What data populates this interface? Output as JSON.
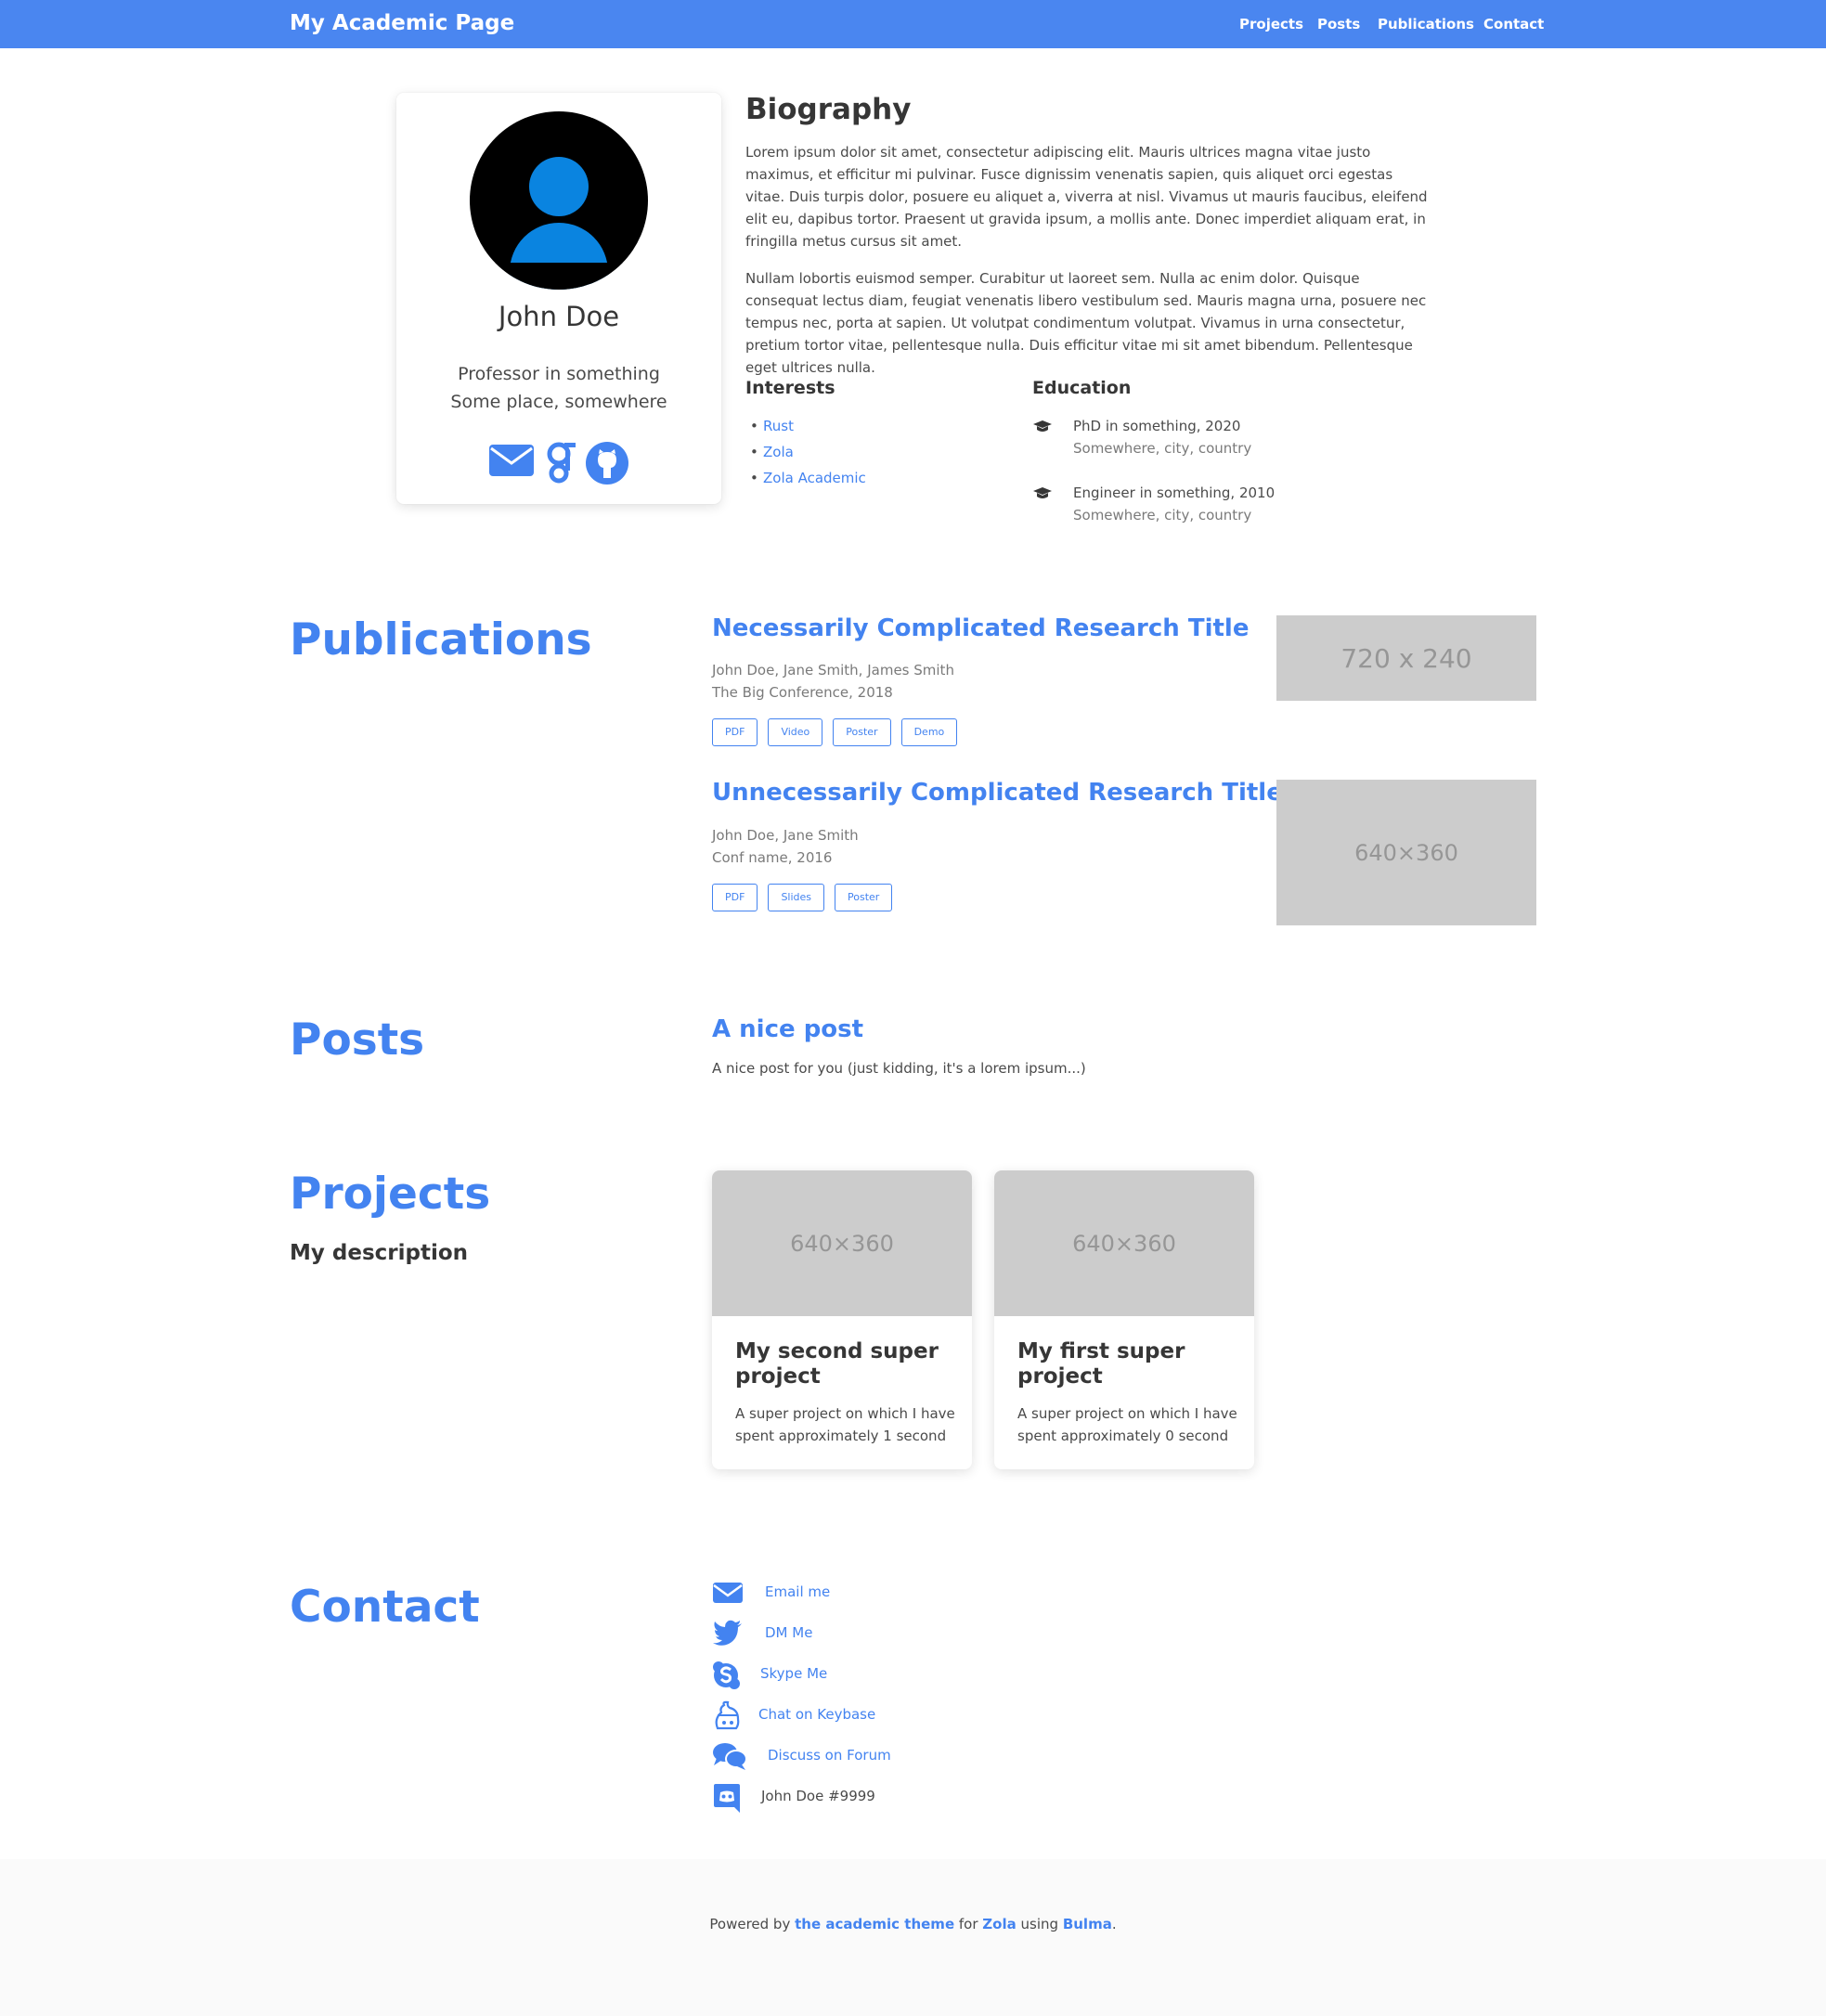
{
  "navbar": {
    "brand": "My Academic Page",
    "links": [
      "Projects",
      "Posts",
      "Publications",
      "Contact"
    ]
  },
  "profile": {
    "name": "John Doe",
    "title": "Professor in something",
    "location": "Some place, somewhere",
    "icons": [
      "envelope-icon",
      "google-scholar-icon",
      "github-icon"
    ]
  },
  "biography": {
    "title": "Biography",
    "paragraphs": [
      "Lorem ipsum dolor sit amet, consectetur adipiscing elit. Mauris ultrices magna vitae justo maximus, et efficitur mi pulvinar. Fusce dignissim venenatis sapien, quis aliquet orci egestas vitae. Duis turpis dolor, posuere eu aliquet a, viverra at nisl. Vivamus ut mauris faucibus, eleifend elit eu, dapibus tortor. Praesent ut gravida ipsum, a mollis ante. Donec imperdiet aliquam erat, in fringilla metus cursus sit amet.",
      "Nullam lobortis euismod semper. Curabitur ut laoreet sem. Nulla ac enim dolor. Quisque consequat lectus diam, feugiat venenatis libero vestibulum sed. Mauris magna urna, posuere nec tempus nec, porta at sapien. Ut volutpat condimentum volutpat. Vivamus in urna consectetur, pretium tortor vitae, pellentesque nulla. Duis efficitur vitae mi sit amet bibendum. Pellentesque eget ultrices nulla."
    ],
    "interests_title": "Interests",
    "interests": [
      "Rust",
      "Zola",
      "Zola Academic"
    ],
    "education_title": "Education",
    "education": [
      {
        "degree": "PhD in something, 2020",
        "place": "Somewhere, city, country"
      },
      {
        "degree": "Engineer in something, 2010",
        "place": "Somewhere, city, country"
      }
    ]
  },
  "publications": {
    "title": "Publications",
    "items": [
      {
        "title": "Necessarily Complicated Research Title",
        "authors": "John Doe, Jane Smith, James Smith",
        "venue": "The Big Conference, 2018",
        "tags": [
          "PDF",
          "Video",
          "Poster",
          "Demo"
        ],
        "image": "720 x 240"
      },
      {
        "title": "Unnecessarily Complicated Research Title",
        "authors": "John Doe, Jane Smith",
        "venue": "Conf name, 2016",
        "tags": [
          "PDF",
          "Slides",
          "Poster"
        ],
        "image": "640×360"
      }
    ]
  },
  "posts": {
    "title": "Posts",
    "items": [
      {
        "title": "A nice post",
        "summary": "A nice post for you (just kidding, it's a lorem ipsum...)"
      }
    ]
  },
  "projects": {
    "title": "Projects",
    "description": "My description",
    "items": [
      {
        "image": "640×360",
        "name": "My second super project",
        "text": "A super project on which I have spent approximately 1 second"
      },
      {
        "image": "640×360",
        "name": "My first super project",
        "text": "A super project on which I have spent approximately 0 second"
      }
    ]
  },
  "contact": {
    "title": "Contact",
    "items": [
      {
        "icon": "envelope-icon",
        "label": "Email me"
      },
      {
        "icon": "twitter-icon",
        "label": "DM Me"
      },
      {
        "icon": "skype-icon",
        "label": "Skype Me"
      },
      {
        "icon": "keybase-icon",
        "label": "Chat on Keybase"
      },
      {
        "icon": "forum-icon",
        "label": "Discuss on Forum"
      },
      {
        "icon": "discord-icon",
        "label": "John Doe #9999"
      }
    ]
  },
  "footer": {
    "prefix": "Powered by ",
    "link1": "the academic theme",
    "mid1": " for ",
    "link2": "Zola",
    "mid2": " using ",
    "link3": "Bulma",
    "suffix": "."
  },
  "colors": {
    "navbar": "#4a86f0",
    "accent": "#4383f0",
    "placeholder": "#cccccc"
  }
}
